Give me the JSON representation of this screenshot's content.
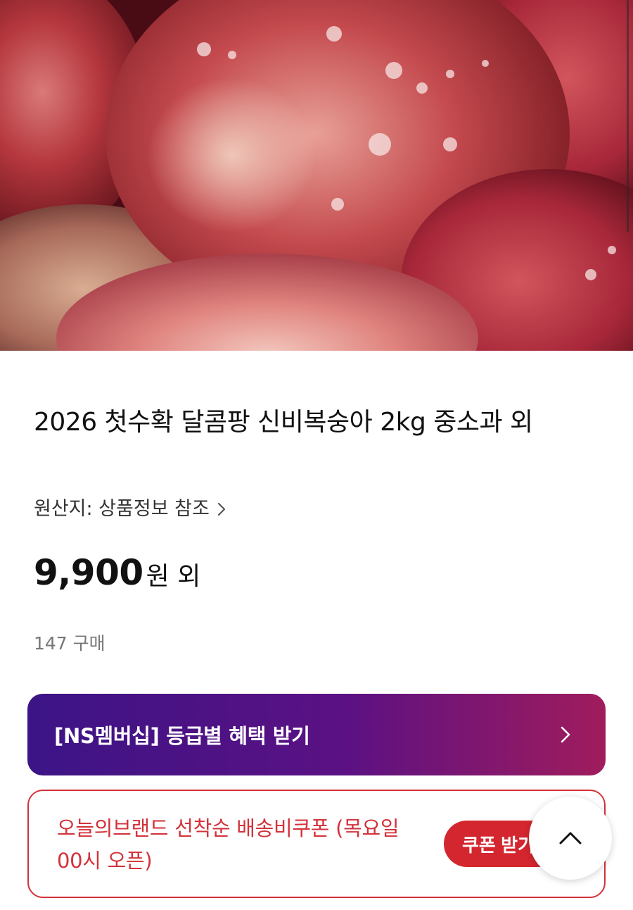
{
  "product": {
    "image_alt": "fresh red peaches with water droplets",
    "title": "2026 첫수확 달콤팡 신비복숭아 2kg 중소과 외",
    "origin": "원산지: 상품정보 참조",
    "price_amount": "9,900",
    "price_unit": "원 외",
    "purchases": "147 구매"
  },
  "membership_banner": {
    "label": "[NS멤버십] 등급별 혜택 받기"
  },
  "coupon_banner": {
    "text": "오늘의브랜드 선착순 배송비쿠폰 (목요일 00시 오픈)",
    "button_label": "쿠폰 받기"
  },
  "colors": {
    "accent_red": "#d3323a",
    "gradient_start": "#3c1486",
    "gradient_end": "#a01c5d"
  }
}
